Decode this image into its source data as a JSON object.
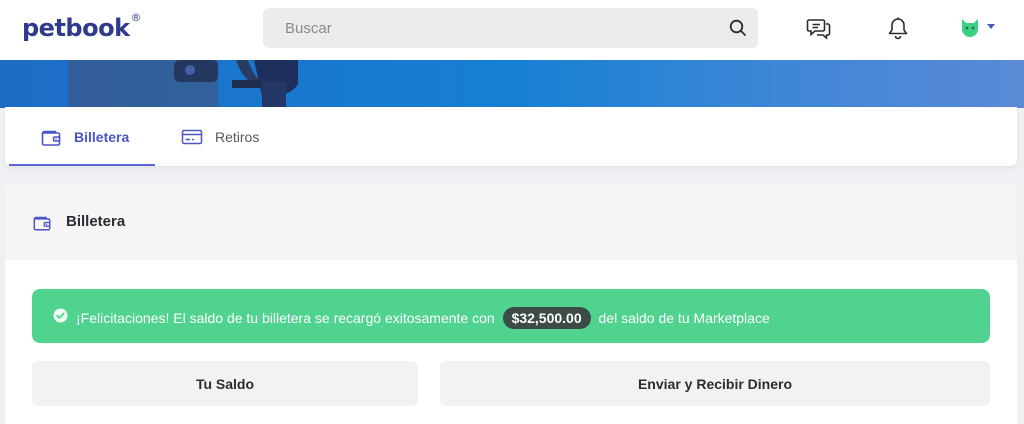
{
  "header": {
    "logo_text": "petbook",
    "logo_mark": "®",
    "search": {
      "placeholder": "Buscar",
      "value": ""
    },
    "icons": [
      "search-icon",
      "chat-icon",
      "bell-icon",
      "cat-avatar-icon",
      "caret-down-icon"
    ]
  },
  "tabs": [
    {
      "label": "Billetera",
      "icon": "wallet-icon",
      "active": true
    },
    {
      "label": "Retiros",
      "icon": "credit-card-icon",
      "active": false
    }
  ],
  "wallet": {
    "title": "Billetera",
    "alert": {
      "prefix": "¡Felicitaciones! El saldo de tu billetera se recargó exitosamente con",
      "amount": "$32,500.00",
      "suffix": "del saldo de tu Marketplace"
    },
    "cards": {
      "balance": "Tu Saldo",
      "send_receive": "Enviar y Recibir Dinero"
    }
  },
  "colors": {
    "brand": "#2f3a8f",
    "accent": "#4a56c8",
    "success": "#4fd38f",
    "avatar": "#3ccf82",
    "banner": "#1680d4"
  }
}
